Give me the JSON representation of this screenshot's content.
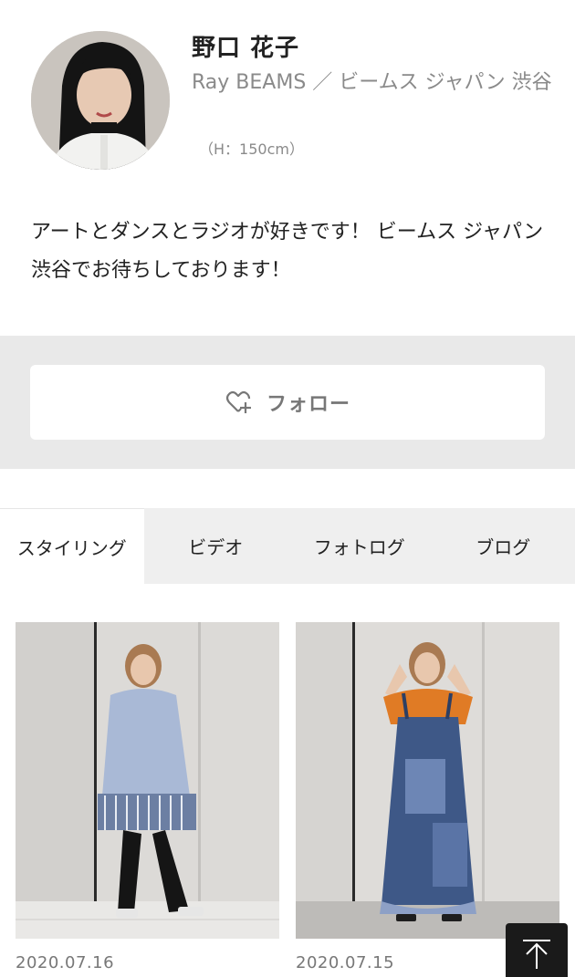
{
  "profile": {
    "name": "野口 花子",
    "shop": "Ray BEAMS ／ ビームス ジャパン 渋谷",
    "height": "（H：150cm）",
    "bio": "アートとダンスとラジオが好きです！ ビームス ジャパン 渋谷でお待ちしております！"
  },
  "follow": {
    "label": "フォロー",
    "icon": "heart-plus-icon"
  },
  "tabs": [
    {
      "label": "スタイリング",
      "active": true
    },
    {
      "label": "ビデオ",
      "active": false
    },
    {
      "label": "フォトログ",
      "active": false
    },
    {
      "label": "ブログ",
      "active": false
    }
  ],
  "stylings": [
    {
      "date": "2020.07.16"
    },
    {
      "date": "2020.07.15"
    }
  ],
  "colors": {
    "follow_area_bg": "#e9e9e9",
    "tab_bar_bg": "#efefef",
    "back_to_top_bg": "#1a1a1a"
  },
  "back_to_top": {
    "icon": "arrow-up-icon"
  }
}
